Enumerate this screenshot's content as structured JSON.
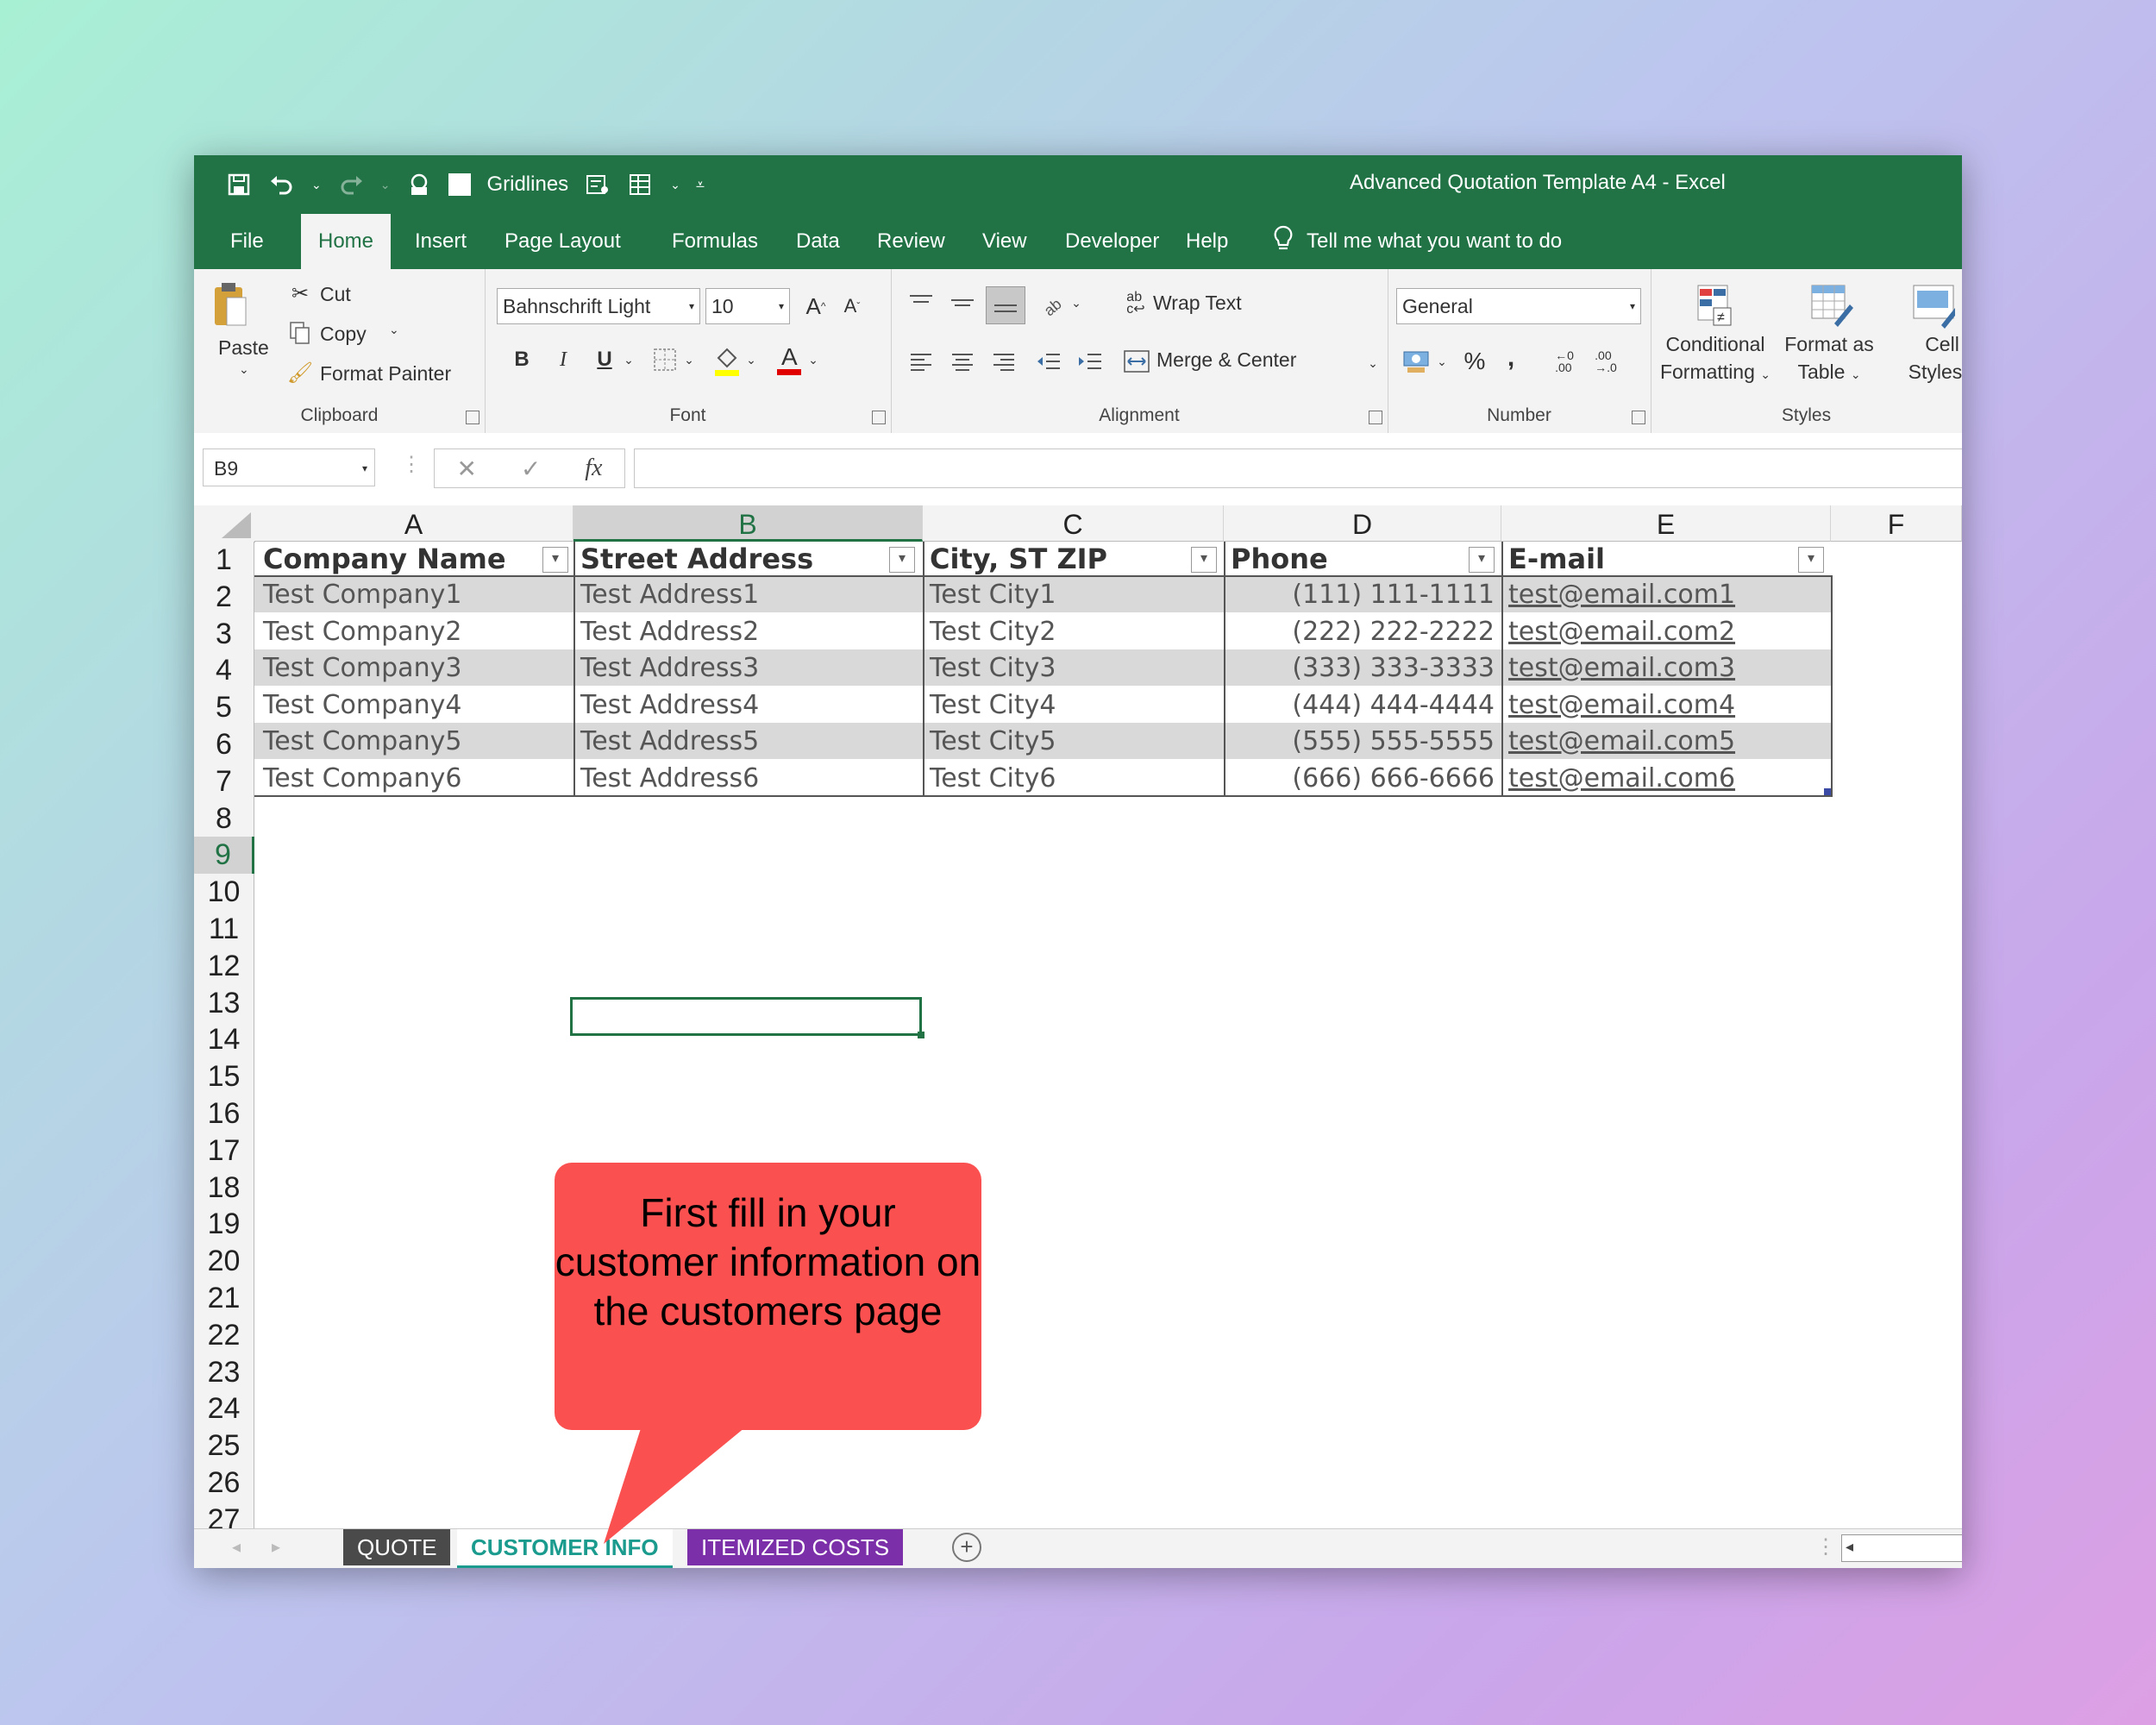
{
  "titlebar": {
    "gridlines_label": "Gridlines",
    "title": "Advanced Quotation Template A4  -  Excel"
  },
  "menu": {
    "tabs": [
      "File",
      "Home",
      "Insert",
      "Page Layout",
      "Formulas",
      "Data",
      "Review",
      "View",
      "Developer",
      "Help"
    ],
    "active": "Home",
    "tell_me": "Tell me what you want to do"
  },
  "ribbon": {
    "clipboard": {
      "paste": "Paste",
      "cut": "Cut",
      "copy": "Copy",
      "format_painter": "Format Painter",
      "label": "Clipboard"
    },
    "font": {
      "name": "Bahnschrift Light",
      "size": "10",
      "label": "Font",
      "bold": "B",
      "italic": "I",
      "underline": "U"
    },
    "alignment": {
      "wrap_text": "Wrap Text",
      "merge_center": "Merge & Center",
      "label": "Alignment"
    },
    "number": {
      "format": "General",
      "percent": "%",
      "comma": ",",
      "label": "Number"
    },
    "styles": {
      "conditional": "Conditional",
      "formatting": "Formatting",
      "format_as": "Format as",
      "table": "Table",
      "cell": "Cell",
      "styles": "Styles",
      "label": "Styles"
    }
  },
  "formula_bar": {
    "name_box": "B9",
    "fx": "fx",
    "formula": ""
  },
  "columns": [
    "A",
    "B",
    "C",
    "D",
    "E",
    "F"
  ],
  "selected_column": "B",
  "rows": [
    "1",
    "2",
    "3",
    "4",
    "5",
    "6",
    "7",
    "8",
    "9",
    "10",
    "11",
    "12",
    "13",
    "14",
    "15",
    "16",
    "17",
    "18",
    "19",
    "20",
    "21",
    "22",
    "23",
    "24",
    "25",
    "26",
    "27"
  ],
  "selected_row": "9",
  "table": {
    "headers": [
      "Company Name",
      "Street Address",
      "City, ST  ZIP",
      "Phone",
      "E-mail"
    ],
    "rows": [
      [
        "Test Company1",
        "Test Address1",
        "Test City1",
        "(111) 111-1111",
        "test@email.com1"
      ],
      [
        "Test Company2",
        "Test Address2",
        "Test City2",
        "(222) 222-2222",
        "test@email.com2"
      ],
      [
        "Test Company3",
        "Test Address3",
        "Test City3",
        "(333) 333-3333",
        "test@email.com3"
      ],
      [
        "Test Company4",
        "Test Address4",
        "Test City4",
        "(444) 444-4444",
        "test@email.com4"
      ],
      [
        "Test Company5",
        "Test Address5",
        "Test City5",
        "(555) 555-5555",
        "test@email.com5"
      ],
      [
        "Test Company6",
        "Test Address6",
        "Test City6",
        "(666) 666-6666",
        "test@email.com6"
      ]
    ]
  },
  "sheets": [
    {
      "name": "QUOTE",
      "bg": "#4a4a4a",
      "fg": "#ffffff"
    },
    {
      "name": "CUSTOMER INFO",
      "bg": "#ffffff",
      "fg": "#1a9b8e"
    },
    {
      "name": "ITEMIZED COSTS",
      "bg": "#7b2fa8",
      "fg": "#ffffff"
    }
  ],
  "callout": {
    "text": "First fill in your customer information on the customers page",
    "color": "#fa5050"
  },
  "colors": {
    "excel_green": "#217346"
  }
}
